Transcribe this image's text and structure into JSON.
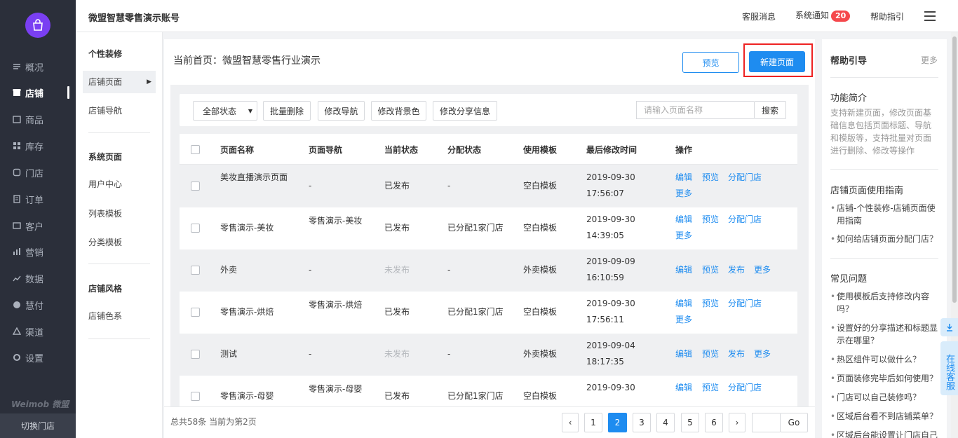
{
  "nav": {
    "items": [
      {
        "label": "概况",
        "icon": "dashboard-icon"
      },
      {
        "label": "店铺",
        "icon": "store-icon",
        "active": true
      },
      {
        "label": "商品",
        "icon": "goods-icon"
      },
      {
        "label": "库存",
        "icon": "inventory-icon"
      },
      {
        "label": "门店",
        "icon": "shop-icon"
      },
      {
        "label": "订单",
        "icon": "order-icon"
      },
      {
        "label": "客户",
        "icon": "customer-icon"
      },
      {
        "label": "营销",
        "icon": "marketing-icon"
      },
      {
        "label": "数据",
        "icon": "data-icon"
      },
      {
        "label": "慧付",
        "icon": "pay-icon"
      },
      {
        "label": "渠道",
        "icon": "channel-icon"
      },
      {
        "label": "设置",
        "icon": "settings-icon"
      }
    ],
    "brand": "Weimob 微盟",
    "switch_store": "切换门店"
  },
  "header": {
    "account": "微盟智慧零售演示账号",
    "service": "客服消息",
    "notice": "系统通知",
    "notice_count": "20",
    "help": "帮助指引"
  },
  "subnav": {
    "sec1": "个性装修",
    "store_page": "店铺页面",
    "store_nav": "店铺导航",
    "sec2": "系统页面",
    "user_center": "用户中心",
    "list_tpl": "列表模板",
    "cat_tpl": "分类模板",
    "sec3": "店铺风格",
    "store_color": "店铺色系"
  },
  "main": {
    "crumb": "当前首页：微盟智慧零售行业演示",
    "preview": "预览",
    "new_page": "新建页面",
    "toolbar": {
      "status": "全部状态",
      "batch_delete": "批量删除",
      "edit_nav": "修改导航",
      "edit_bg": "修改背景色",
      "edit_share": "修改分享信息",
      "search_placeholder": "请输入页面名称",
      "search": "搜索"
    },
    "headers": {
      "name": "页面名称",
      "nav": "页面导航",
      "status": "当前状态",
      "assign": "分配状态",
      "template": "使用模板",
      "time": "最后修改时间",
      "ops": "操作"
    },
    "rows": [
      {
        "name": "美妆直播演示页面",
        "nav": "-",
        "status": "已发布",
        "assign": "-",
        "template": "空白模板",
        "date": "2019-09-30",
        "time": "17:56:07",
        "a1": "编辑",
        "a2": "预览",
        "a3": "分配门店",
        "a4": "更多"
      },
      {
        "name": "零售演示-美妆",
        "nav": "零售演示-美妆",
        "status": "已发布",
        "assign": "已分配1家门店",
        "template": "空白模板",
        "date": "2019-09-30",
        "time": "14:39:05",
        "a1": "编辑",
        "a2": "预览",
        "a3": "分配门店",
        "a4": "更多"
      },
      {
        "name": "外卖",
        "nav": "-",
        "status": "未发布",
        "assign": "-",
        "template": "外卖模板",
        "date": "2019-09-09",
        "time": "16:10:59",
        "a1": "编辑",
        "a2": "预览",
        "a3": "发布",
        "a4": "更多"
      },
      {
        "name": "零售演示-烘焙",
        "nav": "零售演示-烘焙",
        "status": "已发布",
        "assign": "已分配1家门店",
        "template": "空白模板",
        "date": "2019-09-30",
        "time": "17:56:11",
        "a1": "编辑",
        "a2": "预览",
        "a3": "分配门店",
        "a4": "更多"
      },
      {
        "name": "测试",
        "nav": "-",
        "status": "未发布",
        "assign": "-",
        "template": "外卖模板",
        "date": "2019-09-04",
        "time": "18:17:35",
        "a1": "编辑",
        "a2": "预览",
        "a3": "发布",
        "a4": "更多"
      },
      {
        "name": "零售演示-母婴",
        "nav": "零售演示-母婴",
        "status": "已发布",
        "assign": "已分配1家门店",
        "template": "空白模板",
        "date": "2019-09-30",
        "time": "",
        "a1": "编辑",
        "a2": "预览",
        "a3": "分配门店",
        "a4": ""
      }
    ],
    "footer": {
      "total": "总共58条 当前为第2页",
      "prev": "‹",
      "pages": [
        "1",
        "2",
        "3",
        "4",
        "5",
        "6"
      ],
      "current_page": "2",
      "next": "›",
      "go": "Go"
    }
  },
  "help": {
    "title": "帮助引导",
    "more": "更多",
    "intro_title": "功能简介",
    "intro_desc": "支持新建页面，修改页面基础信息包括页面标题、导航和模版等，支持批量对页面进行删除、修改等操作",
    "guide_title": "店铺页面使用指南",
    "guide_links": [
      "店铺-个性装修-店铺页面使用指南",
      "如何给店铺页面分配门店？"
    ],
    "faq_title": "常见问题",
    "faq_links": [
      "使用模板后支持修改内容吗？",
      "设置好的分享描述和标题显示在哪里？",
      "热区组件可以做什么？",
      "页面装修完毕后如何使用？",
      "门店可以自己装修吗？",
      "区域后台看不到店铺菜单？",
      "区域后台能设置让门店自己"
    ]
  },
  "float": {
    "cs": "在线客服"
  },
  "colors": {
    "nav_bg": "#2b2f3a",
    "primary": "#1e8cf0",
    "badge": "#f5484c",
    "highlight": "#ee2222"
  }
}
